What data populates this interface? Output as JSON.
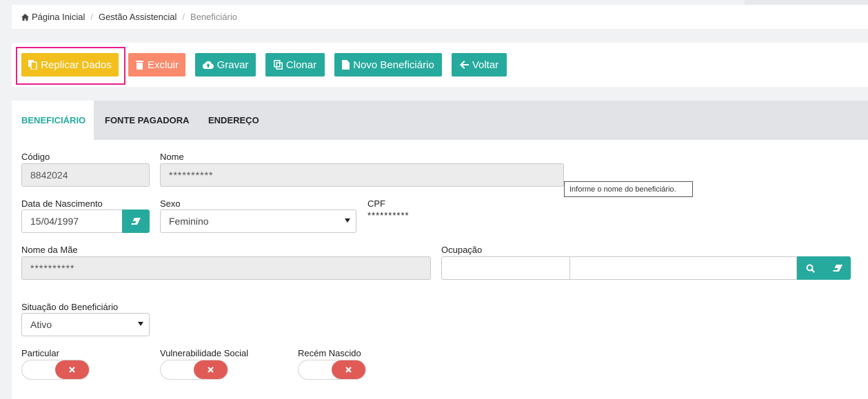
{
  "breadcrumb": {
    "home": "Página Inicial",
    "section": "Gestão Assistencial",
    "current": "Beneficiário",
    "separator": "/"
  },
  "toolbar": {
    "replicar": "Replicar Dados",
    "excluir": "Excluir",
    "gravar": "Gravar",
    "clonar": "Clonar",
    "novo": "Novo Beneficiário",
    "voltar": "Voltar"
  },
  "tabs": [
    "BENEFICIÁRIO",
    "FONTE PAGADORA",
    "ENDEREÇO"
  ],
  "form": {
    "codigo_label": "Código",
    "codigo_value": "8842024",
    "nome_label": "Nome",
    "nome_value": "**********",
    "nome_tooltip": "Informe o nome do beneficiário.",
    "nascimento_label": "Data de Nascimento",
    "nascimento_value": "15/04/1997",
    "sexo_label": "Sexo",
    "sexo_value": "Feminino",
    "cpf_label": "CPF",
    "cpf_value": "**********",
    "mae_label": "Nome da Mãe",
    "mae_value": "**********",
    "ocupacao_label": "Ocupação",
    "ocupacao_code": "",
    "ocupacao_desc": "",
    "situacao_label": "Situação do Beneficiário",
    "situacao_value": "Ativo",
    "particular_label": "Particular",
    "vulnerabilidade_label": "Vulnerabilidade Social",
    "recem_label": "Recém Nascido"
  },
  "colors": {
    "accent": "#26aa9d",
    "yellow": "#f2bf1c",
    "salmon": "#fb8a6c",
    "highlight": "#ea1e88",
    "switch_off": "#e05b56"
  },
  "icons": [
    "home-icon",
    "copy-icon",
    "trash-icon",
    "cloud-upload-icon",
    "clone-icon",
    "file-icon",
    "arrow-left-icon",
    "eraser-icon",
    "search-icon",
    "close-icon"
  ]
}
